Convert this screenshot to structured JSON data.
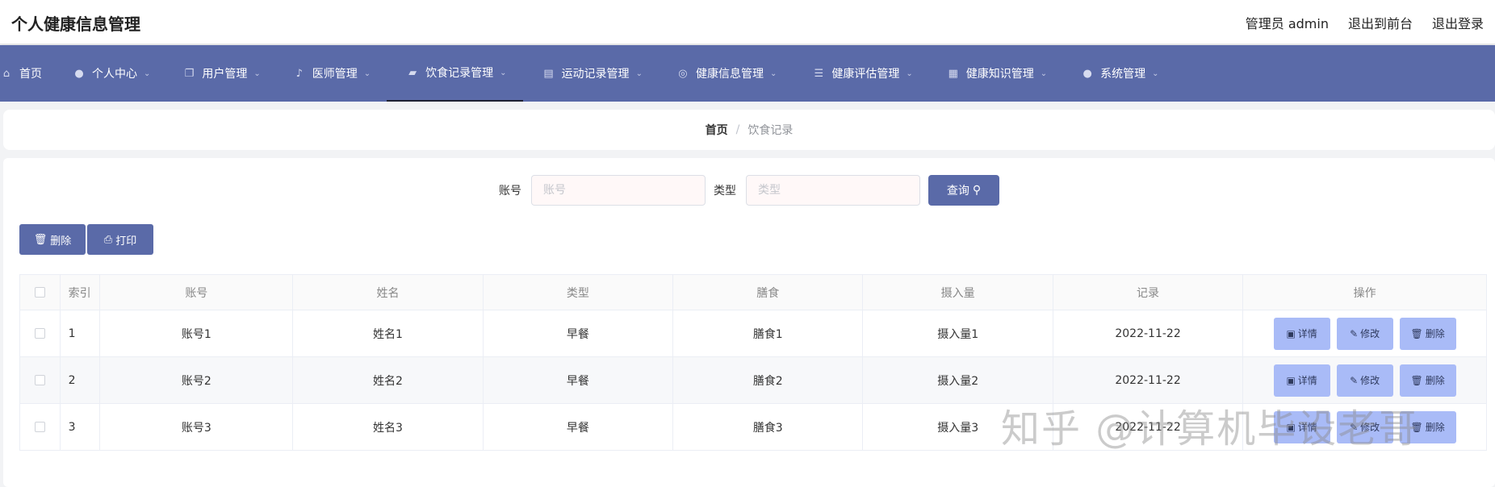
{
  "app": {
    "title": "个人健康信息管理"
  },
  "topbar": {
    "admin_label": "管理员 admin",
    "front_label": "退出到前台",
    "logout_label": "退出登录"
  },
  "nav": {
    "items": [
      {
        "label": "首页",
        "icon": "home-icon"
      },
      {
        "label": "个人中心",
        "icon": "user-icon"
      },
      {
        "label": "用户管理",
        "icon": "copy-icon"
      },
      {
        "label": "医师管理",
        "icon": "microphone-icon"
      },
      {
        "label": "饮食记录管理",
        "icon": "thumb-icon"
      },
      {
        "label": "运动记录管理",
        "icon": "clipboard-icon"
      },
      {
        "label": "健康信息管理",
        "icon": "compass-icon"
      },
      {
        "label": "健康评估管理",
        "icon": "list-icon"
      },
      {
        "label": "健康知识管理",
        "icon": "grid-icon"
      },
      {
        "label": "系统管理",
        "icon": "person-icon"
      }
    ],
    "active_index": 4
  },
  "breadcrumb": {
    "home": "首页",
    "separator": "/",
    "current": "饮食记录"
  },
  "search": {
    "account_label": "账号",
    "account_placeholder": "账号",
    "type_label": "类型",
    "type_placeholder": "类型",
    "query_label": "查询"
  },
  "actions": {
    "delete_label": "删除",
    "print_label": "打印"
  },
  "table": {
    "headers": [
      "索引",
      "账号",
      "姓名",
      "类型",
      "膳食",
      "摄入量",
      "记录",
      "操作"
    ],
    "rows": [
      [
        "1",
        "账号1",
        "姓名1",
        "早餐",
        "膳食1",
        "摄入量1",
        "2022-11-22"
      ],
      [
        "2",
        "账号2",
        "姓名2",
        "早餐",
        "膳食2",
        "摄入量2",
        "2022-11-22"
      ],
      [
        "3",
        "账号3",
        "姓名3",
        "早餐",
        "膳食3",
        "摄入量3",
        "2022-11-22"
      ]
    ],
    "ops": {
      "detail": "详情",
      "edit": "修改",
      "delete": "删除"
    }
  },
  "watermark": "知乎 @计算机毕设老哥",
  "colors": {
    "nav_bg": "#5a6aa8",
    "op_btn": "#a9bbf7"
  }
}
